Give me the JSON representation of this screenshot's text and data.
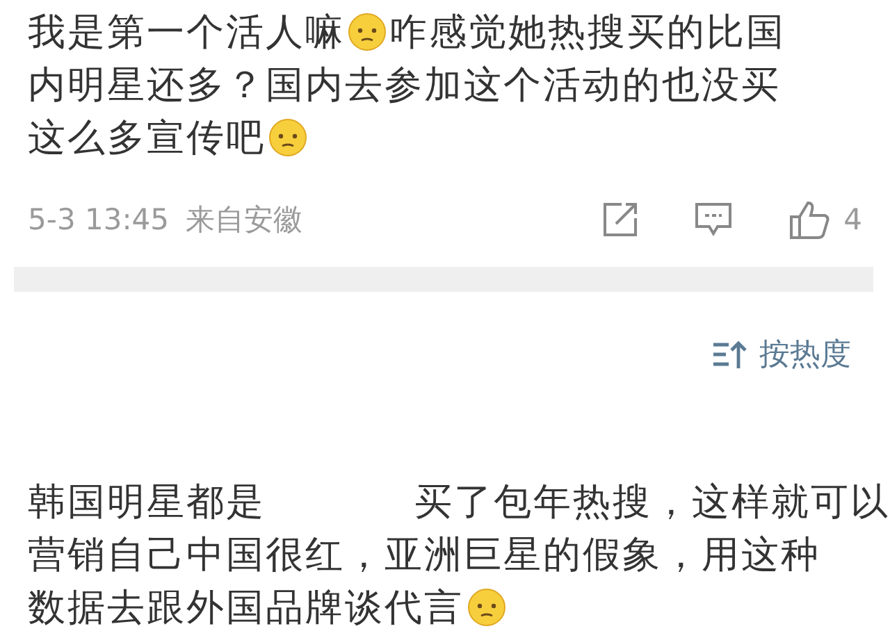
{
  "comments": [
    {
      "lines": [
        [
          {
            "kind": "text",
            "text": "我是第一个活人嘛"
          },
          {
            "kind": "emoji"
          },
          {
            "kind": "text",
            "text": "咋感觉她热搜买的比国"
          }
        ],
        [
          {
            "kind": "text",
            "text": "内明星还多？国内去参加这个活动的也没买"
          }
        ],
        [
          {
            "kind": "text",
            "text": "这么多宣传吧"
          },
          {
            "kind": "emoji"
          }
        ]
      ],
      "time": "5-3 13:45",
      "source": "来自安徽",
      "likes": "4"
    },
    {
      "lines": [
        [
          {
            "kind": "text",
            "text": "韩国明星都是"
          },
          {
            "kind": "blank"
          },
          {
            "kind": "text",
            "text": "买了包年热搜，这样就可以"
          }
        ],
        [
          {
            "kind": "text",
            "text": "营销自己中国很红，亚洲巨星的假象，用这种"
          }
        ],
        [
          {
            "kind": "text",
            "text": "数据去跟外国品牌谈代言"
          },
          {
            "kind": "emoji"
          }
        ]
      ]
    }
  ],
  "sort": {
    "label": "按热度"
  }
}
